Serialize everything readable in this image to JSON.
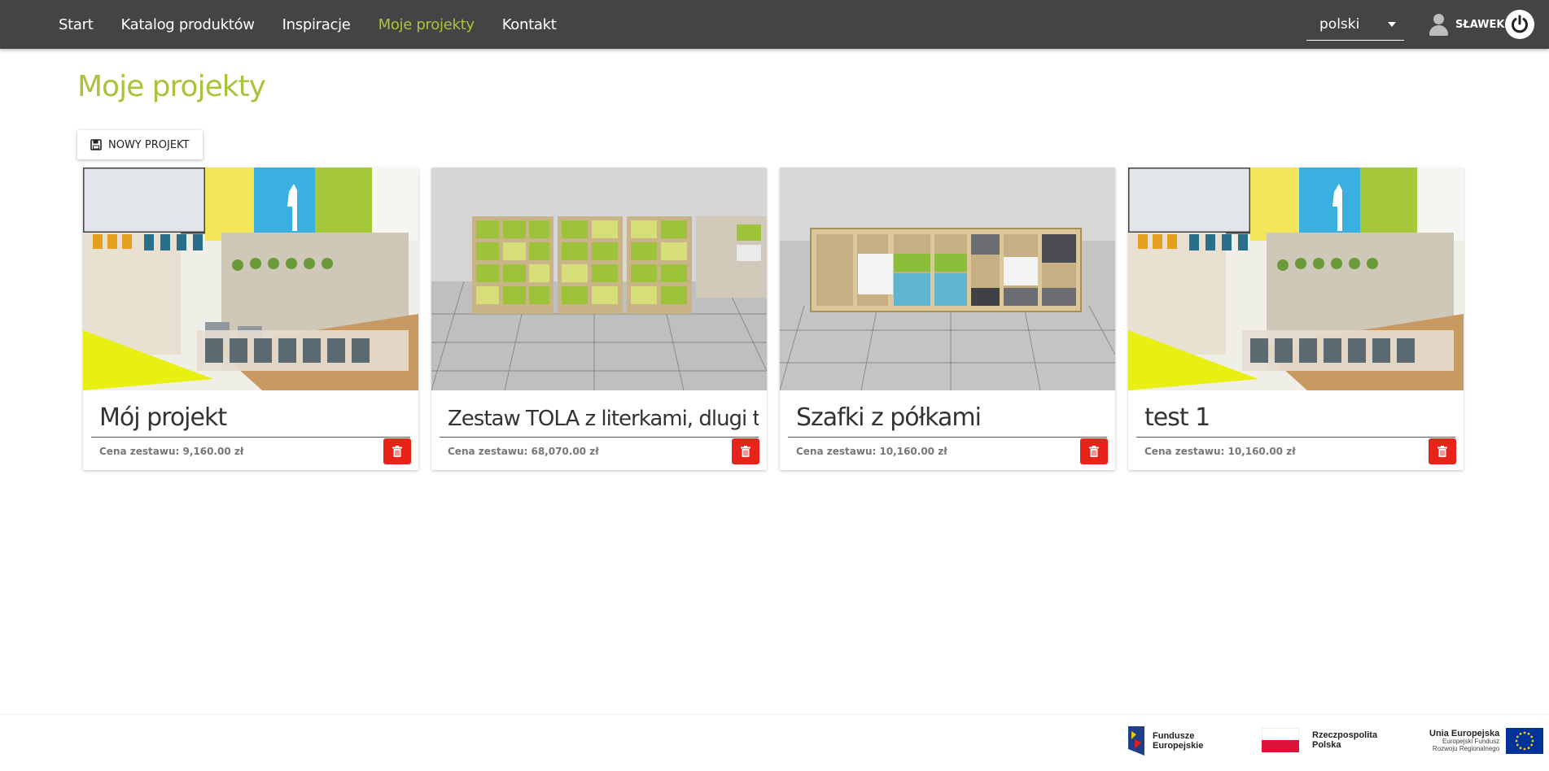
{
  "nav": {
    "links": [
      "Start",
      "Katalog produktów",
      "Inspiracje",
      "Moje projekty",
      "Kontakt"
    ],
    "active_index": 3
  },
  "language": {
    "selected": "polski"
  },
  "user": {
    "name": "SŁAWEK"
  },
  "page": {
    "title": "Moje projekty",
    "new_project_label": "NOWY PROJEKT"
  },
  "projects": [
    {
      "name": "Mój projekt",
      "price": "Cena zestawu: 9,160.00 zł"
    },
    {
      "name": "Zestaw TOLA z literkami, dlugi tekst",
      "price": "Cena zestawu: 68,070.00 zł"
    },
    {
      "name": "Szafki z półkami",
      "price": "Cena zestawu: 10,160.00 zł"
    },
    {
      "name": "test 1",
      "price": "Cena zestawu: 10,160.00 zł"
    }
  ],
  "footer": {
    "fe_line1": "Fundusze",
    "fe_line2": "Europejskie",
    "rp_line1": "Rzeczpospolita",
    "rp_line2": "Polska",
    "ue_line1": "Unia Europejska",
    "ue_line2": "Europejski Fundusz",
    "ue_line3": "Rozwoju Regionalnego"
  },
  "colors": {
    "navbar": "#444444",
    "accent_green": "#a8c43a",
    "delete_red": "#e8231a"
  },
  "icons": [
    "user-icon",
    "power-icon",
    "save-icon",
    "trash-icon",
    "chevron-down-icon",
    "eu-flag-icon",
    "pl-flag-icon",
    "fe-logo-icon"
  ]
}
